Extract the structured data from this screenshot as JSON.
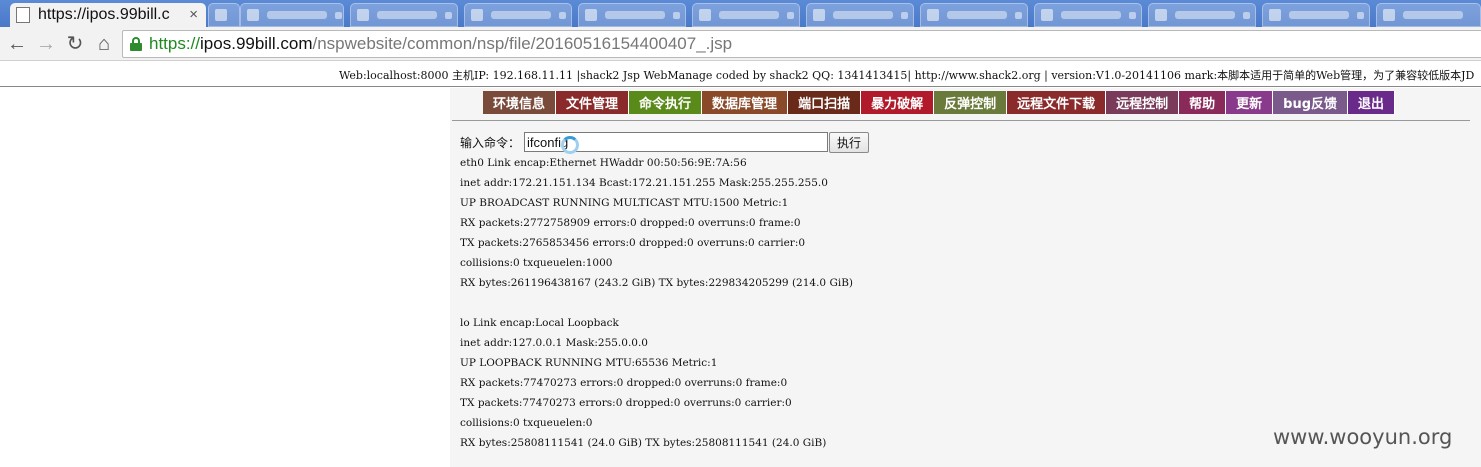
{
  "browser": {
    "active_tab_title": "https://ipos.99bill.c",
    "address": {
      "scheme": "https://",
      "host": "ipos.99bill.com",
      "path": "/nspwebsite/common/nsp/file/20160516154400407_.jsp"
    }
  },
  "infobar": {
    "text": "Web:localhost:8000 主机IP: 192.168.11.11 |shack2 Jsp WebManage coded by shack2 QQ: 1341413415| http://www.shack2.org | version:V1.0-20141106 mark:本脚本适用于简单的Web管理，为了兼容较低版本JD"
  },
  "menu": [
    {
      "label": "环境信息",
      "color": "#7a4a3a"
    },
    {
      "label": "文件管理",
      "color": "#8a2a2a"
    },
    {
      "label": "命令执行",
      "color": "#5a8a1a"
    },
    {
      "label": "数据库管理",
      "color": "#8a4a2a"
    },
    {
      "label": "端口扫描",
      "color": "#6a2a1a"
    },
    {
      "label": "暴力破解",
      "color": "#b01a2a"
    },
    {
      "label": "反弹控制",
      "color": "#6a7a3a"
    },
    {
      "label": "远程文件下载",
      "color": "#8a2a2a"
    },
    {
      "label": "远程控制",
      "color": "#7a3a5a"
    },
    {
      "label": "帮助",
      "color": "#8a2a5a"
    },
    {
      "label": "更新",
      "color": "#8a3a8a"
    },
    {
      "label": "bug反馈",
      "color": "#7a5a8a"
    },
    {
      "label": "退出",
      "color": "#6a2a8a"
    }
  ],
  "command": {
    "label": "输入命令：",
    "value": "ifconfig",
    "run_label": "执行"
  },
  "output": [
    "eth0 Link encap:Ethernet HWaddr 00:50:56:9E:7A:56",
    "inet addr:172.21.151.134 Bcast:172.21.151.255 Mask:255.255.255.0",
    "UP BROADCAST RUNNING MULTICAST MTU:1500 Metric:1",
    "RX packets:2772758909 errors:0 dropped:0 overruns:0 frame:0",
    "TX packets:2765853456 errors:0 dropped:0 overruns:0 carrier:0",
    "collisions:0 txqueuelen:1000",
    "RX bytes:261196438167 (243.2 GiB) TX bytes:229834205299 (214.0 GiB)",
    "",
    "lo Link encap:Local Loopback",
    "inet addr:127.0.0.1 Mask:255.0.0.0",
    "UP LOOPBACK RUNNING MTU:65536 Metric:1",
    "RX packets:77470273 errors:0 dropped:0 overruns:0 frame:0",
    "TX packets:77470273 errors:0 dropped:0 overruns:0 carrier:0",
    "collisions:0 txqueuelen:0",
    "RX bytes:25808111541 (24.0 GiB) TX bytes:25808111541 (24.0 GiB)"
  ],
  "watermark": "www.wooyun.org",
  "icons": {
    "back": "back-arrow-icon",
    "forward": "forward-arrow-icon",
    "reload": "reload-icon",
    "home": "home-icon",
    "lock": "lock-icon"
  }
}
